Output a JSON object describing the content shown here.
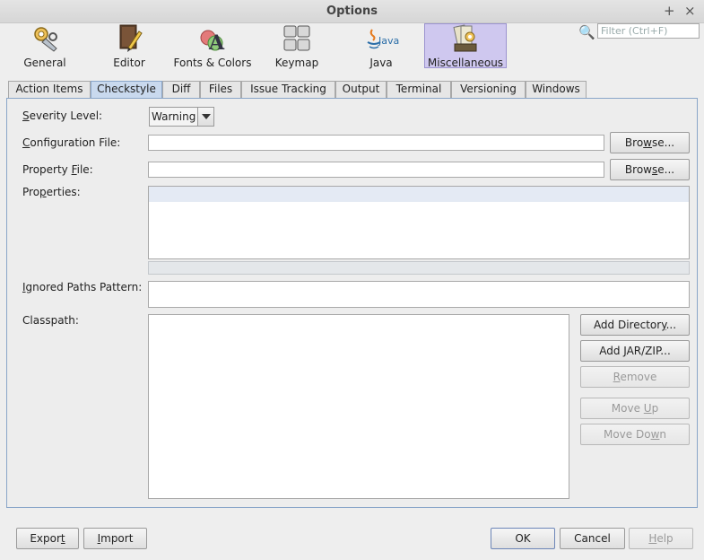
{
  "window": {
    "title": "Options",
    "pin_glyph": "+",
    "close_glyph": "×"
  },
  "categories": [
    {
      "label": "General"
    },
    {
      "label": "Editor"
    },
    {
      "label": "Fonts & Colors"
    },
    {
      "label": "Keymap"
    },
    {
      "label": "Java"
    },
    {
      "label": "Miscellaneous",
      "selected": true
    }
  ],
  "search": {
    "placeholder": "Filter (Ctrl+F)",
    "icon": "search-icon"
  },
  "tabs": [
    {
      "label": "Action Items"
    },
    {
      "label": "Checkstyle",
      "selected": true
    },
    {
      "label": "Diff"
    },
    {
      "label": "Files"
    },
    {
      "label": "Issue Tracking"
    },
    {
      "label": "Output"
    },
    {
      "label": "Terminal"
    },
    {
      "label": "Versioning"
    },
    {
      "label": "Windows"
    }
  ],
  "form": {
    "severity_level": {
      "label_mnemonic": "S",
      "label_rest": "everity Level:",
      "value": "Warning"
    },
    "configuration_file": {
      "label_mnemonic": "C",
      "label_rest": "onfiguration File:",
      "value": "",
      "browse": {
        "pre": "Bro",
        "mnemonic": "w",
        "post": "se..."
      }
    },
    "property_file": {
      "label_pre": "Property ",
      "label_mnemonic": "F",
      "label_rest": "ile:",
      "value": "",
      "browse": {
        "pre": "Brow",
        "mnemonic": "s",
        "post": "e..."
      }
    },
    "properties": {
      "label_pre": "Pro",
      "label_mnemonic": "p",
      "label_rest": "erties:"
    },
    "ignored_paths": {
      "label_mnemonic": "I",
      "label_rest": "gnored Paths Pattern:",
      "value": ""
    },
    "classpath": {
      "label": "Classpath:"
    }
  },
  "classpath_buttons": {
    "add_directory": {
      "pre": "Add Directory",
      "mnemonic": "",
      "post": "...",
      "underline_index": "y"
    },
    "add_jar": {
      "pre": "Add ",
      "mnemonic": "J",
      "post": "AR/ZIP..."
    },
    "remove": {
      "pre": "",
      "mnemonic": "R",
      "post": "emove"
    },
    "move_up": {
      "pre": "Move ",
      "mnemonic": "U",
      "post": "p"
    },
    "move_down": {
      "pre": "Move Do",
      "mnemonic": "w",
      "post": "n"
    }
  },
  "footer": {
    "export": {
      "pre": "Expor",
      "mnemonic": "t",
      "post": ""
    },
    "import": {
      "pre": "",
      "mnemonic": "I",
      "post": "mport"
    },
    "ok": "OK",
    "cancel": "Cancel",
    "help": {
      "pre": "",
      "mnemonic": "H",
      "post": "elp"
    }
  },
  "colors": {
    "accent_tab": "#c9d9ee",
    "selected_category": "#cfc8ef",
    "window_bg": "#eeeeee"
  }
}
